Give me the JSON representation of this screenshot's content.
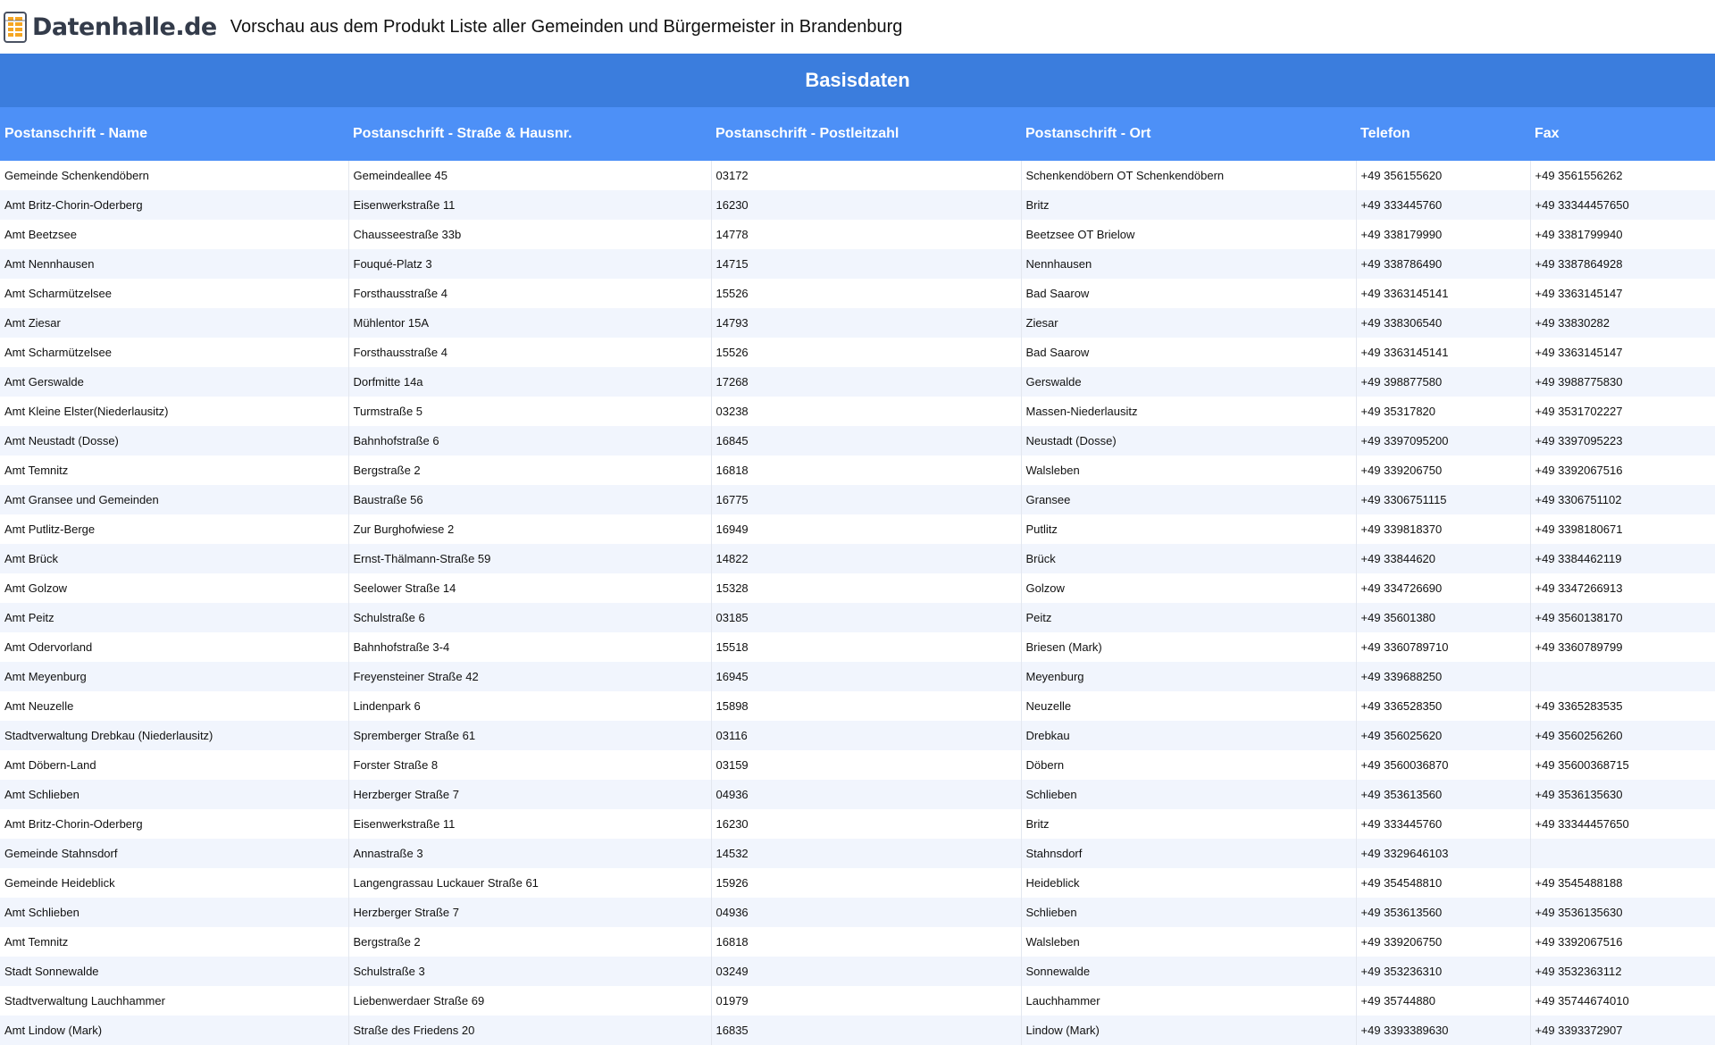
{
  "brand": {
    "logo_text": "Datenhalle.de",
    "logo_icon": "database-stack-icon",
    "colors": {
      "text": "#333b4a",
      "accent": "#f5a623"
    }
  },
  "header": {
    "title": "Vorschau aus dem Produkt Liste aller Gemeinden und Bürgermeister in Brandenburg"
  },
  "table": {
    "section_title": "Basisdaten",
    "colors": {
      "section": "#3b7ddd",
      "header": "#4d90f7",
      "stripe": "#f1f5fd"
    },
    "columns": [
      "Postanschrift - Name",
      "Postanschrift - Straße & Hausnr.",
      "Postanschrift - Postleitzahl",
      "Postanschrift - Ort",
      "Telefon",
      "Fax"
    ],
    "rows": [
      [
        "Gemeinde Schenkendöbern",
        "Gemeindeallee 45",
        "03172",
        "Schenkendöbern OT Schenkendöbern",
        "+49 356155620",
        "+49 3561556262"
      ],
      [
        "Amt Britz-Chorin-Oderberg",
        "Eisenwerkstraße 11",
        "16230",
        "Britz",
        "+49 333445760",
        "+49 33344457650"
      ],
      [
        "Amt Beetzsee",
        "Chausseestraße 33b",
        "14778",
        "Beetzsee OT Brielow",
        "+49 338179990",
        "+49 3381799940"
      ],
      [
        "Amt Nennhausen",
        "Fouqué-Platz 3",
        "14715",
        "Nennhausen",
        "+49 338786490",
        "+49 3387864928"
      ],
      [
        "Amt Scharmützelsee",
        "Forsthausstraße 4",
        "15526",
        "Bad Saarow",
        "+49 3363145141",
        "+49 3363145147"
      ],
      [
        "Amt Ziesar",
        "Mühlentor 15A",
        "14793",
        "Ziesar",
        "+49 338306540",
        "+49 33830282"
      ],
      [
        "Amt Scharmützelsee",
        "Forsthausstraße 4",
        "15526",
        "Bad Saarow",
        "+49 3363145141",
        "+49 3363145147"
      ],
      [
        "Amt Gerswalde",
        "Dorfmitte 14a",
        "17268",
        "Gerswalde",
        "+49 398877580",
        "+49 3988775830"
      ],
      [
        "Amt Kleine Elster(Niederlausitz)",
        "Turmstraße 5",
        "03238",
        "Massen-Niederlausitz",
        "+49 35317820",
        "+49 3531702227"
      ],
      [
        "Amt Neustadt (Dosse)",
        "Bahnhofstraße 6",
        "16845",
        "Neustadt (Dosse)",
        "+49 3397095200",
        "+49 3397095223"
      ],
      [
        "Amt Temnitz",
        "Bergstraße 2",
        "16818",
        "Walsleben",
        "+49 339206750",
        "+49 3392067516"
      ],
      [
        "Amt Gransee und Gemeinden",
        "Baustraße 56",
        "16775",
        "Gransee",
        "+49 3306751115",
        "+49 3306751102"
      ],
      [
        "Amt Putlitz-Berge",
        "Zur Burghofwiese 2",
        "16949",
        "Putlitz",
        "+49 339818370",
        "+49 3398180671"
      ],
      [
        "Amt Brück",
        "Ernst-Thälmann-Straße 59",
        "14822",
        "Brück",
        "+49 33844620",
        "+49 3384462119"
      ],
      [
        "Amt Golzow",
        "Seelower Straße 14",
        "15328",
        "Golzow",
        "+49 334726690",
        "+49 3347266913"
      ],
      [
        "Amt Peitz",
        "Schulstraße 6",
        "03185",
        "Peitz",
        "+49 35601380",
        "+49 3560138170"
      ],
      [
        "Amt Odervorland",
        "Bahnhofstraße 3-4",
        "15518",
        "Briesen (Mark)",
        "+49 3360789710",
        "+49 3360789799"
      ],
      [
        "Amt Meyenburg",
        "Freyensteiner Straße 42",
        "16945",
        "Meyenburg",
        "+49 339688250",
        ""
      ],
      [
        "Amt Neuzelle",
        "Lindenpark 6",
        "15898",
        "Neuzelle",
        "+49 336528350",
        "+49 3365283535"
      ],
      [
        "Stadtverwaltung Drebkau (Niederlausitz)",
        "Spremberger Straße 61",
        "03116",
        "Drebkau",
        "+49 356025620",
        "+49 3560256260"
      ],
      [
        "Amt Döbern-Land",
        "Forster Straße 8",
        "03159",
        "Döbern",
        "+49 3560036870",
        "+49 35600368715"
      ],
      [
        "Amt Schlieben",
        "Herzberger Straße 7",
        "04936",
        "Schlieben",
        "+49 353613560",
        "+49 3536135630"
      ],
      [
        "Amt Britz-Chorin-Oderberg",
        "Eisenwerkstraße 11",
        "16230",
        "Britz",
        "+49 333445760",
        "+49 33344457650"
      ],
      [
        "Gemeinde Stahnsdorf",
        "Annastraße 3",
        "14532",
        "Stahnsdorf",
        "+49 3329646103",
        ""
      ],
      [
        "Gemeinde Heideblick",
        "Langengrassau Luckauer Straße 61",
        "15926",
        "Heideblick",
        "+49 354548810",
        "+49 3545488188"
      ],
      [
        "Amt Schlieben",
        "Herzberger Straße 7",
        "04936",
        "Schlieben",
        "+49 353613560",
        "+49 3536135630"
      ],
      [
        "Amt Temnitz",
        "Bergstraße 2",
        "16818",
        "Walsleben",
        "+49 339206750",
        "+49 3392067516"
      ],
      [
        "Stadt Sonnewalde",
        "Schulstraße 3",
        "03249",
        "Sonnewalde",
        "+49 353236310",
        "+49 3532363112"
      ],
      [
        "Stadtverwaltung Lauchhammer",
        "Liebenwerdaer Straße 69",
        "01979",
        "Lauchhammer",
        "+49 35744880",
        "+49 35744674010"
      ],
      [
        "Amt Lindow (Mark)",
        "Straße des Friedens 20",
        "16835",
        "Lindow (Mark)",
        "+49 3393389630",
        "+49 3393372907"
      ]
    ]
  }
}
